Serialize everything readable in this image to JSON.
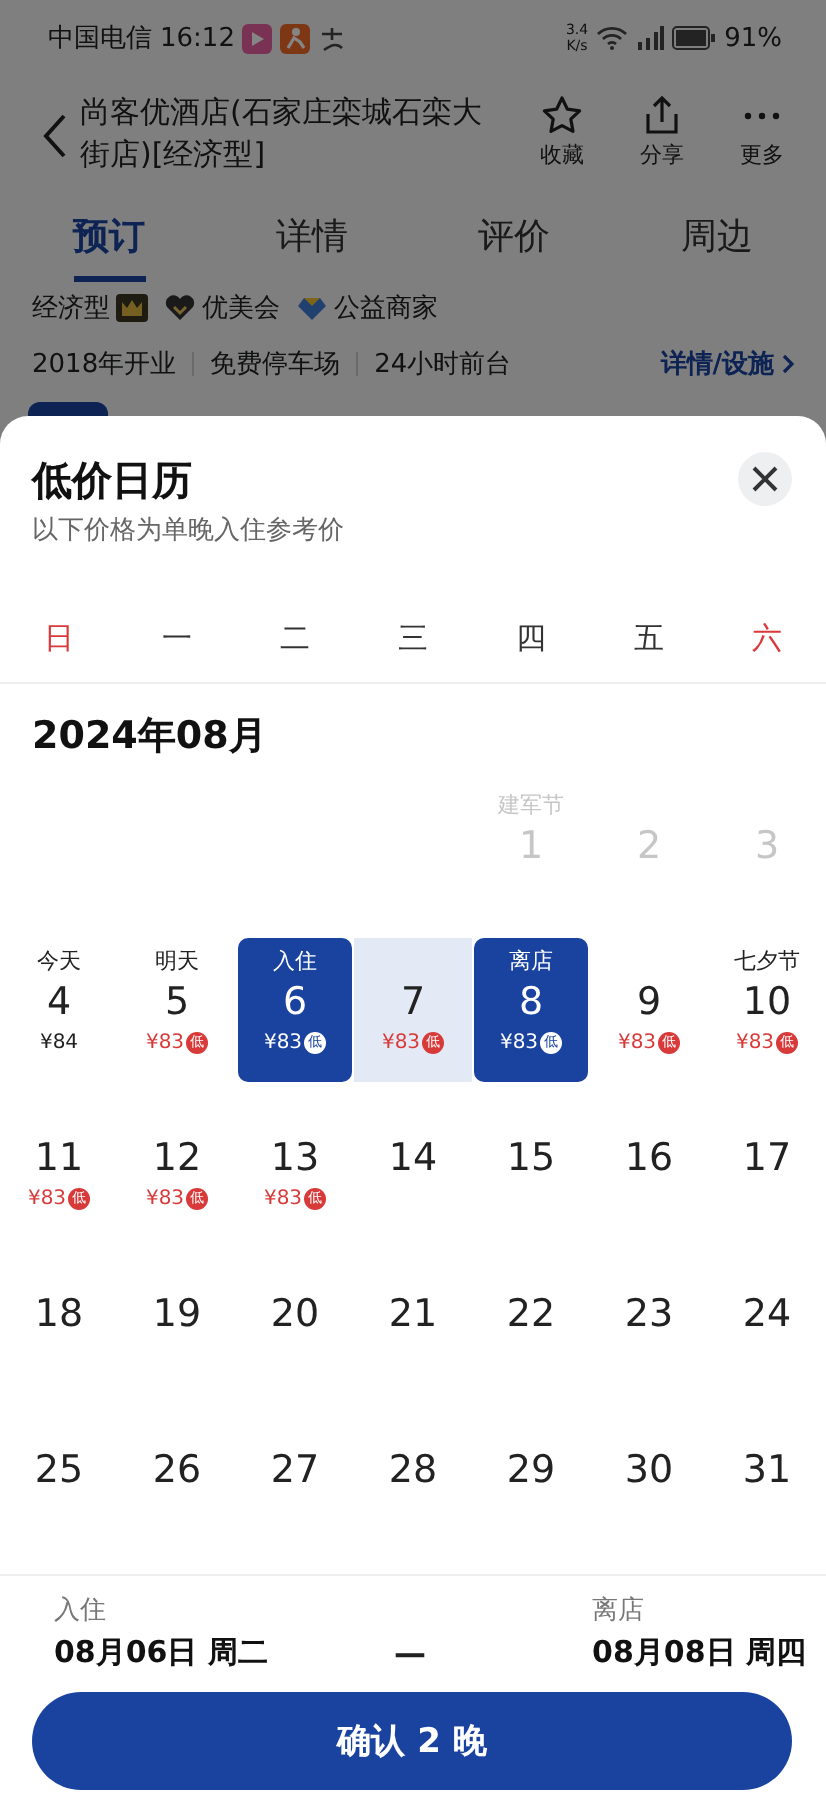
{
  "status_bar": {
    "carrier": "中国电信",
    "time": "16:12",
    "speed": "3.4",
    "speed_unit": "K/s",
    "battery": "91%"
  },
  "header": {
    "title": "尚客优酒店(石家庄栾城石栾大街店)[经济型]",
    "actions": [
      {
        "label": "收藏",
        "kind": "star"
      },
      {
        "label": "分享",
        "kind": "share"
      },
      {
        "label": "更多",
        "kind": "more"
      }
    ]
  },
  "tabs": [
    {
      "label": "预订",
      "selected": true
    },
    {
      "label": "详情",
      "selected": false
    },
    {
      "label": "评价",
      "selected": false
    },
    {
      "label": "周边",
      "selected": false
    }
  ],
  "tags": [
    {
      "label": "经济型",
      "kind": "crown"
    },
    {
      "label": "优美会",
      "kind": "heart"
    },
    {
      "label": "公益商家",
      "kind": "diamond"
    }
  ],
  "facts": [
    "2018年开业",
    "免费停车场",
    "24小时前台"
  ],
  "facts_link": "详情/设施",
  "calendar": {
    "title": "低价日历",
    "subtitle": "以下价格为单晚入住参考价",
    "weekdays": [
      {
        "label": "日",
        "weekend": true
      },
      {
        "label": "一",
        "weekend": false
      },
      {
        "label": "二",
        "weekend": false
      },
      {
        "label": "三",
        "weekend": false
      },
      {
        "label": "四",
        "weekend": false
      },
      {
        "label": "五",
        "weekend": false
      },
      {
        "label": "六",
        "weekend": true
      }
    ],
    "month": "2024年08月",
    "weeks": [
      [
        {
          "day": "1",
          "label": "建军节",
          "disabled": true,
          "selected": false,
          "in_range": false
        },
        {
          "day": "2",
          "disabled": true,
          "selected": false,
          "in_range": false
        },
        {
          "day": "3",
          "disabled": true,
          "selected": false,
          "in_range": false
        }
      ],
      [
        {
          "day": "4",
          "label": "今天",
          "price": "¥84",
          "disabled": false,
          "selected": false,
          "in_range": false
        },
        {
          "day": "5",
          "label": "明天",
          "price": "¥83",
          "badge": "低",
          "disabled": false,
          "selected": false,
          "in_range": false
        },
        {
          "day": "6",
          "label": "入住",
          "price": "¥83",
          "badge": "低",
          "disabled": false,
          "selected": true,
          "in_range": false
        },
        {
          "day": "7",
          "price": "¥83",
          "badge": "低",
          "disabled": false,
          "selected": false,
          "in_range": true
        },
        {
          "day": "8",
          "label": "离店",
          "price": "¥83",
          "badge": "低",
          "disabled": false,
          "selected": true,
          "in_range": false
        },
        {
          "day": "9",
          "price": "¥83",
          "badge": "低",
          "disabled": false,
          "selected": false,
          "in_range": false
        },
        {
          "day": "10",
          "label": "七夕节",
          "price": "¥83",
          "badge": "低",
          "disabled": false,
          "selected": false,
          "in_range": false
        }
      ],
      [
        {
          "day": "11",
          "price": "¥83",
          "badge": "低",
          "disabled": false,
          "selected": false,
          "in_range": false
        },
        {
          "day": "12",
          "price": "¥83",
          "badge": "低",
          "disabled": false,
          "selected": false,
          "in_range": false
        },
        {
          "day": "13",
          "price": "¥83",
          "badge": "低",
          "disabled": false,
          "selected": false,
          "in_range": false
        },
        {
          "day": "14",
          "disabled": false,
          "selected": false,
          "in_range": false
        },
        {
          "day": "15",
          "disabled": false,
          "selected": false,
          "in_range": false
        },
        {
          "day": "16",
          "disabled": false,
          "selected": false,
          "in_range": false
        },
        {
          "day": "17",
          "disabled": false,
          "selected": false,
          "in_range": false
        }
      ],
      [
        {
          "day": "18",
          "disabled": false,
          "selected": false,
          "in_range": false
        },
        {
          "day": "19",
          "disabled": false,
          "selected": false,
          "in_range": false
        },
        {
          "day": "20",
          "disabled": false,
          "selected": false,
          "in_range": false
        },
        {
          "day": "21",
          "disabled": false,
          "selected": false,
          "in_range": false
        },
        {
          "day": "22",
          "disabled": false,
          "selected": false,
          "in_range": false
        },
        {
          "day": "23",
          "disabled": false,
          "selected": false,
          "in_range": false
        },
        {
          "day": "24",
          "disabled": false,
          "selected": false,
          "in_range": false
        }
      ],
      [
        {
          "day": "25",
          "disabled": false,
          "selected": false,
          "in_range": false
        },
        {
          "day": "26",
          "disabled": false,
          "selected": false,
          "in_range": false
        },
        {
          "day": "27",
          "disabled": false,
          "selected": false,
          "in_range": false
        },
        {
          "day": "28",
          "disabled": false,
          "selected": false,
          "in_range": false
        },
        {
          "day": "29",
          "disabled": false,
          "selected": false,
          "in_range": false
        },
        {
          "day": "30",
          "disabled": false,
          "selected": false,
          "in_range": false
        },
        {
          "day": "31",
          "disabled": false,
          "selected": false,
          "in_range": false
        }
      ]
    ]
  },
  "stay": {
    "checkin_label": "入住",
    "checkin": "08月06日 周二",
    "separator": "—",
    "checkout_label": "离店",
    "checkout": "08月08日 周四"
  },
  "confirm_button": "确认 2 晚"
}
